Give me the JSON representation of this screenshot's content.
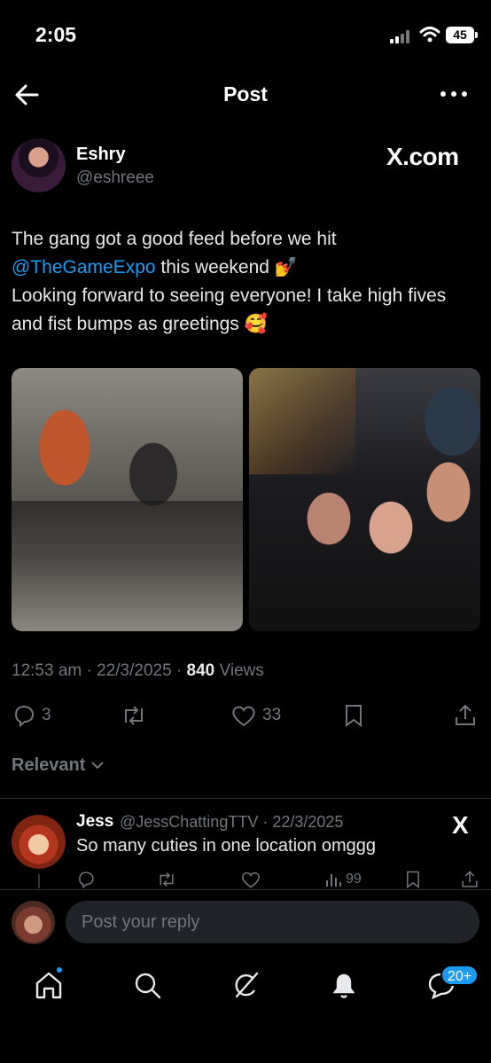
{
  "status_bar": {
    "time": "2:05",
    "battery": "45"
  },
  "header": {
    "title": "Post"
  },
  "post": {
    "author_name": "Eshry",
    "author_handle": "@eshreee",
    "source_logo": "X.com",
    "text_line1_pre": "The gang got a good feed before we hit",
    "mention": "@TheGameExpo",
    "text_line2_post": " this weekend ",
    "emoji1": "💅",
    "text_line3": "Looking forward to seeing everyone! I take high fives and fist bumps as greetings ",
    "emoji2": "🥰",
    "time": "12:53 am",
    "date": "22/3/2025",
    "views_count": "840",
    "views_label": "Views",
    "replies": "3",
    "likes": "33"
  },
  "sort_label": "Relevant",
  "reply": {
    "name": "Jess",
    "handle_date": "@JessChattingTTV · 22/3/2025",
    "logo": "X",
    "text": "So many cuties in one location omggg",
    "views": "99"
  },
  "composer": {
    "placeholder": "Post your reply"
  },
  "nav": {
    "badge": "20+"
  },
  "colors": {
    "accent": "#1d9bf0",
    "background": "#000000",
    "muted": "#71767b",
    "text": "#e7e9ea"
  },
  "icons": [
    "back-arrow-icon",
    "more-icon",
    "reply-icon",
    "repost-icon",
    "like-icon",
    "bookmark-icon",
    "share-icon",
    "chevron-down-icon",
    "home-icon",
    "search-icon",
    "grok-icon",
    "notifications-icon",
    "messages-icon",
    "views-icon",
    "signal-icon",
    "wifi-icon"
  ]
}
